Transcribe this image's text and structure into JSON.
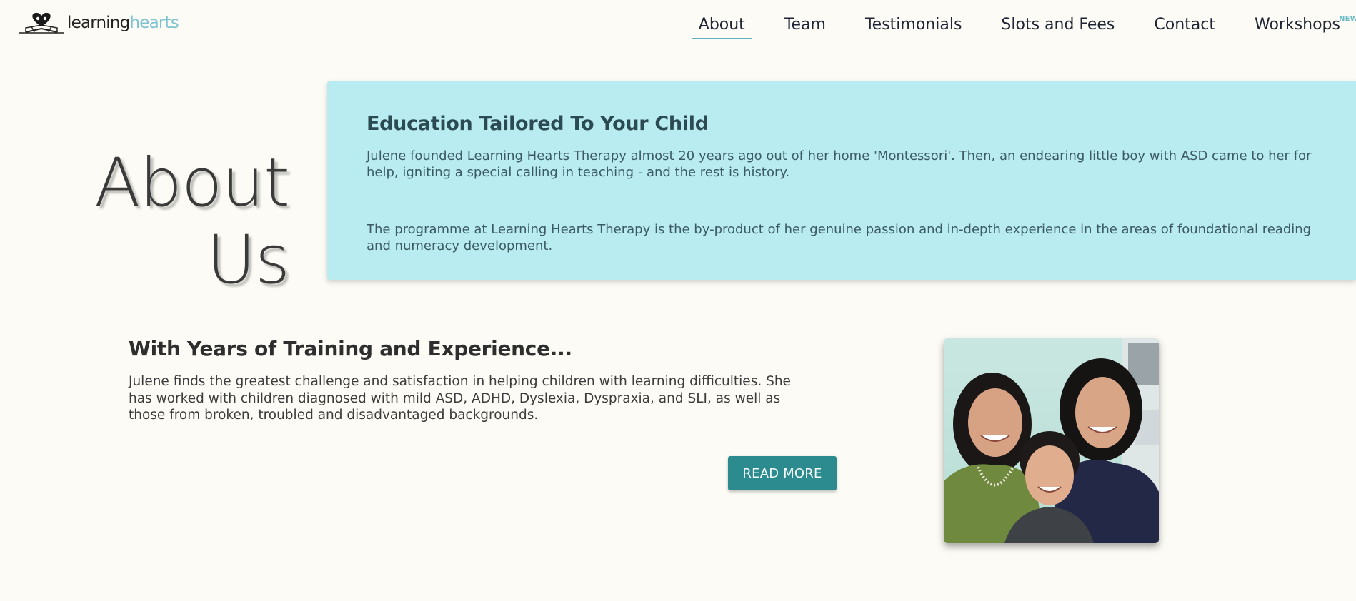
{
  "header": {
    "logo": {
      "part1": "learning",
      "part2": "hearts"
    },
    "nav": [
      {
        "label": "About",
        "active": true
      },
      {
        "label": "Team"
      },
      {
        "label": "Testimonials"
      },
      {
        "label": "Slots and Fees"
      },
      {
        "label": "Contact"
      },
      {
        "label": "Workshops",
        "badge": "NEW!"
      }
    ]
  },
  "hero": {
    "title_line1": "About",
    "title_line2": "Us",
    "card": {
      "heading": "Education Tailored To Your Child",
      "paragraph1": "Julene founded Learning Hearts Therapy almost 20 years ago out of her home 'Montessori'. Then, an endearing little boy with ASD came to her for help, igniting a special calling in teaching - and the rest is history.",
      "paragraph2": "The programme at Learning Hearts Therapy is the by-product of her genuine passion and in-depth experience in the areas of foundational reading and numeracy development."
    }
  },
  "training": {
    "heading": "With Years of Training and Experience...",
    "paragraph": "Julene finds the greatest challenge and satisfaction in helping children with learning difficulties. She has worked with children diagnosed with mild ASD, ADHD, Dyslexia, Dyspraxia, and SLI, as well as those from broken, troubled and disadvantaged backgrounds.",
    "button_label": "READ MORE"
  },
  "colors": {
    "background": "#fcfbf5",
    "card": "#b9ecf1",
    "accent": "#2c8b8e",
    "logo_accent": "#7ec4d0"
  }
}
